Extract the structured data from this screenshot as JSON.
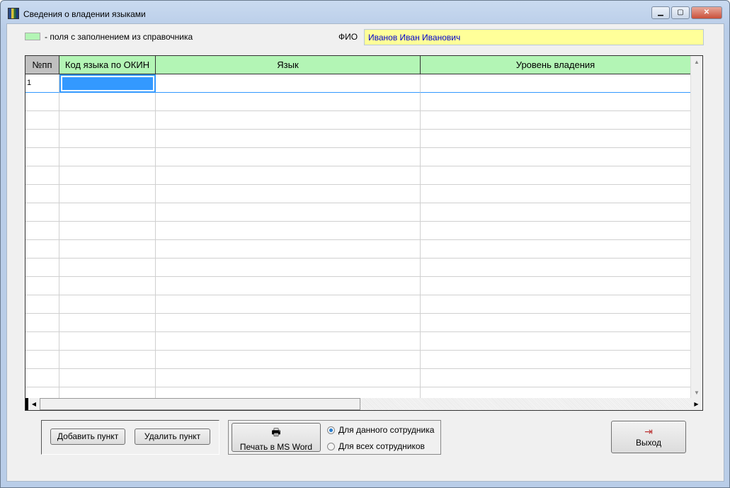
{
  "window": {
    "title": "Сведения о владении языками",
    "minimize": "▁",
    "maximize": "▢",
    "close": "✕"
  },
  "legend": {
    "text": "- поля с заполнением из справочника",
    "color": "#b3f5b5"
  },
  "fio": {
    "label": "ФИО",
    "value": "Иванов Иван Иванович"
  },
  "grid": {
    "columns": [
      "№пп",
      "Код языка по ОКИН",
      "Язык",
      "Уровень владения"
    ],
    "rows": [
      [
        "1",
        "",
        "",
        ""
      ]
    ]
  },
  "buttons": {
    "add": "Добавить пункт",
    "delete": "Удалить пункт",
    "print": "Печать в MS Word",
    "exit": "Выход"
  },
  "radios": [
    {
      "label": "Для данного сотрудника",
      "checked": true
    },
    {
      "label": "Для всех сотрудников",
      "checked": false
    }
  ]
}
